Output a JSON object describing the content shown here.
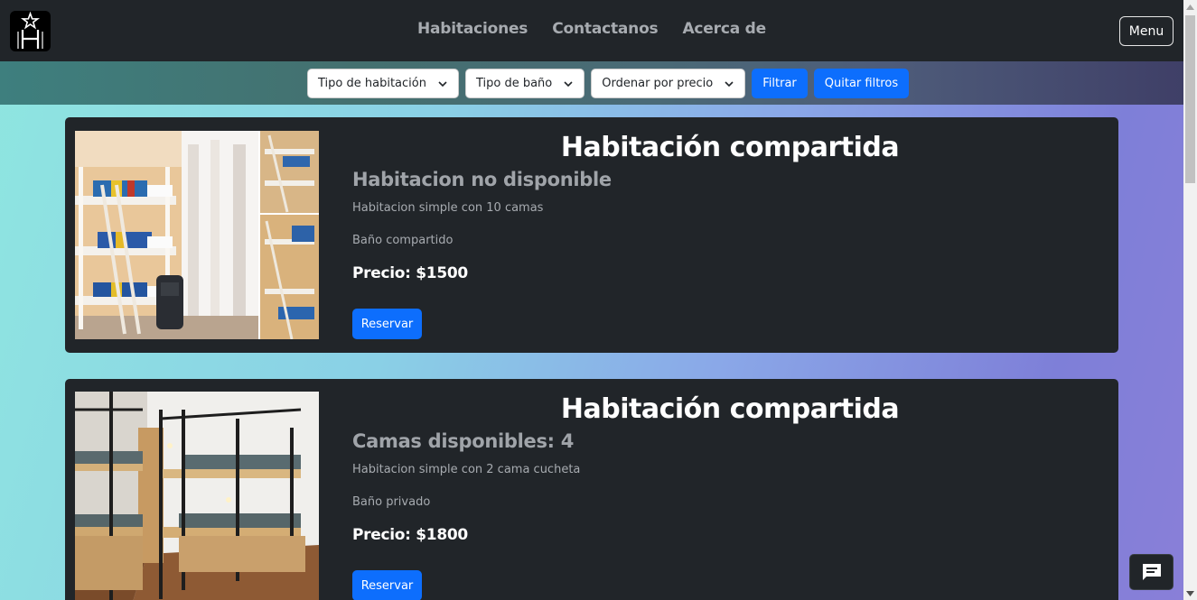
{
  "nav": {
    "links": [
      "Habitaciones",
      "Contactanos",
      "Acerca de"
    ],
    "menu_label": "Menu"
  },
  "filters": {
    "room_type": "Tipo de habitación",
    "bath_type": "Tipo de baño",
    "sort_price": "Ordenar por precio",
    "filter_label": "Filtrar",
    "clear_label": "Quitar filtros"
  },
  "rooms": [
    {
      "title": "Habitación compartida",
      "availability": "Habitacion no disponible",
      "description": "Habitacion simple con 10 camas",
      "bath": "Baño compartido",
      "price": "Precio: $1500",
      "reserve_label": "Reservar"
    },
    {
      "title": "Habitación compartida",
      "availability": "Camas disponibles: 4",
      "description": "Habitacion simple con 2 cama cucheta",
      "bath": "Baño privado",
      "price": "Precio: $1800",
      "reserve_label": "Reservar"
    }
  ],
  "colors": {
    "navbar": "#212529",
    "accent": "#0d6efd",
    "card": "#212529"
  },
  "icons": [
    "logo-icon",
    "chevron-down-icon",
    "chat-icon"
  ]
}
